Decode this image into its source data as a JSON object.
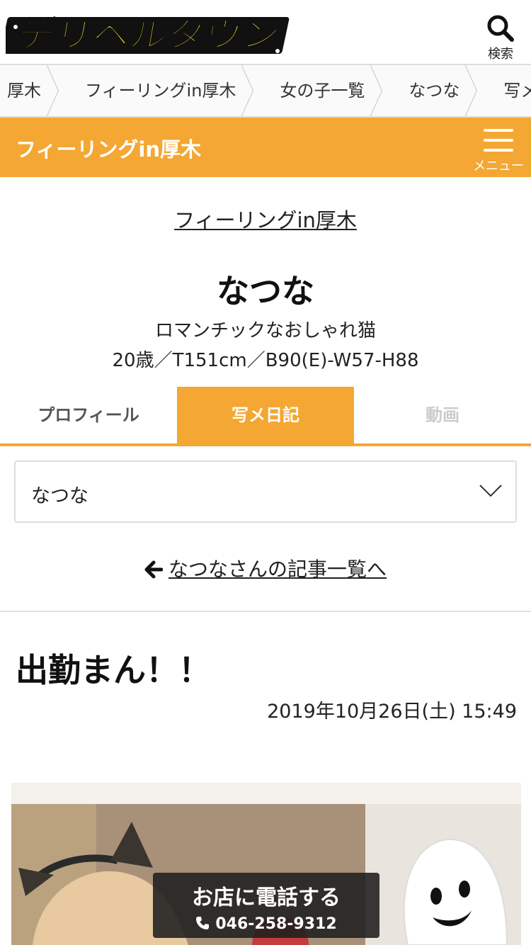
{
  "header": {
    "logo_text": "デリヘルタウン",
    "search_label": "検索"
  },
  "breadcrumb": [
    "厚木",
    "フィーリングin厚木",
    "女の子一覧",
    "なつな",
    "写メ日記"
  ],
  "shop_bar": {
    "title": "フィーリングin厚木",
    "menu_label": "メニュー"
  },
  "shop_link": "フィーリングin厚木",
  "girl": {
    "name": "なつな",
    "catchphrase": "ロマンチックなおしゃれ猫",
    "spec": "20歳／T151cm／B90(E)-W57-H88"
  },
  "tabs": [
    {
      "label": "プロフィール",
      "state": "normal"
    },
    {
      "label": "写メ日記",
      "state": "active"
    },
    {
      "label": "動画",
      "state": "disabled"
    }
  ],
  "select": {
    "value": "なつな"
  },
  "back_link": "なつなさんの記事一覧へ",
  "post": {
    "title": "出勤まん！！",
    "date": "2019年10月26日(土) 15:49"
  },
  "call": {
    "label": "お店に電話する",
    "number": "046-258-9312"
  },
  "colors": {
    "accent": "#f4a733",
    "logo_yellow": "#ffe600",
    "call_bg": "#1e1e1e"
  }
}
